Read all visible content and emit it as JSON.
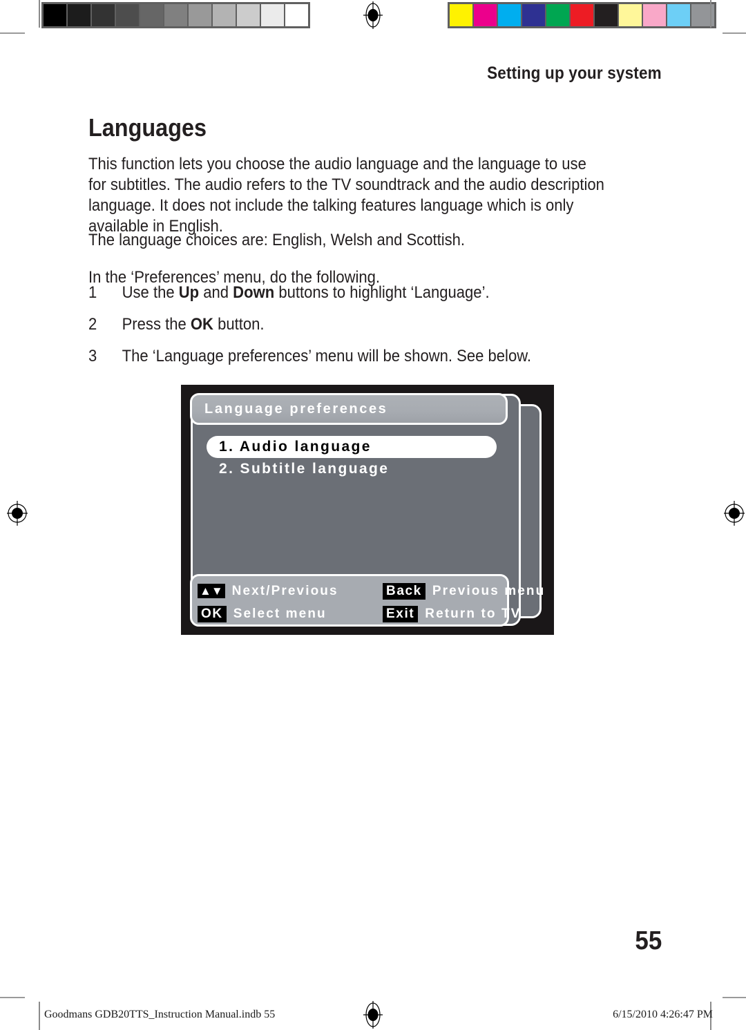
{
  "document": {
    "running_head": "Setting up your system",
    "page_title": "Languages",
    "folio": "55"
  },
  "body": {
    "paragraph_1": "This function lets you choose the audio language and the language to use for subtitles. The audio refers to the TV soundtrack and the audio description language. It does not include the talking features language which is only available in English.",
    "paragraph_2": "The language choices are: English, Welsh and Scottish.",
    "paragraph_3": "In the ‘Preferences’ menu, do the following."
  },
  "steps": [
    {
      "number": "1",
      "text_before": "Use the ",
      "bold_1": "Up",
      "text_middle": " and ",
      "bold_2": "Down",
      "text_after": " buttons to highlight ‘Language’."
    },
    {
      "number": "2",
      "text_before": "Press the ",
      "bold_1": "OK",
      "text_middle": "",
      "bold_2": "",
      "text_after": " button."
    },
    {
      "number": "3",
      "text_before": "The ‘Language preferences’ menu will be shown. See below.",
      "bold_1": "",
      "text_middle": "",
      "bold_2": "",
      "text_after": ""
    }
  ],
  "osd": {
    "title": "Language preferences",
    "menu_items": [
      {
        "label": "1. Audio language",
        "selected": true
      },
      {
        "label": "2. Subtitle language",
        "selected": false
      }
    ],
    "hints": [
      {
        "key": "▲▼",
        "key_name": "up-down-arrows",
        "label": "Next/Previous"
      },
      {
        "key": "Back",
        "key_name": "back",
        "label": "Previous menu"
      },
      {
        "key": "OK",
        "key_name": "ok",
        "label": "Select menu"
      },
      {
        "key": "Exit",
        "key_name": "exit",
        "label": "Return to TV"
      }
    ],
    "colors": {
      "screen_background": "#1a1718",
      "panel": "#6b6f76",
      "title_bar": "#a7abb1",
      "footer_bar": "#a7abb1",
      "selected_item": "#ffffff",
      "key_background": "#000000"
    }
  },
  "print_marks": {
    "grayscale_swatches": [
      "#000000",
      "#1c1c1c",
      "#333333",
      "#4d4d4d",
      "#666666",
      "#808080",
      "#999999",
      "#b3b3b3",
      "#cccccc",
      "#ebebeb",
      "#ffffff"
    ],
    "color_swatches": [
      "#fff200",
      "#ec008c",
      "#00aeef",
      "#2e3192",
      "#00a651",
      "#ed1c24",
      "#231f20",
      "#fff79a",
      "#f9a8c8",
      "#6dcff6",
      "#939598"
    ]
  },
  "footer": {
    "file_slug": "Goodmans GDB20TTS_Instruction Manual.indb   55",
    "timestamp": "6/15/2010   4:26:47 PM"
  }
}
